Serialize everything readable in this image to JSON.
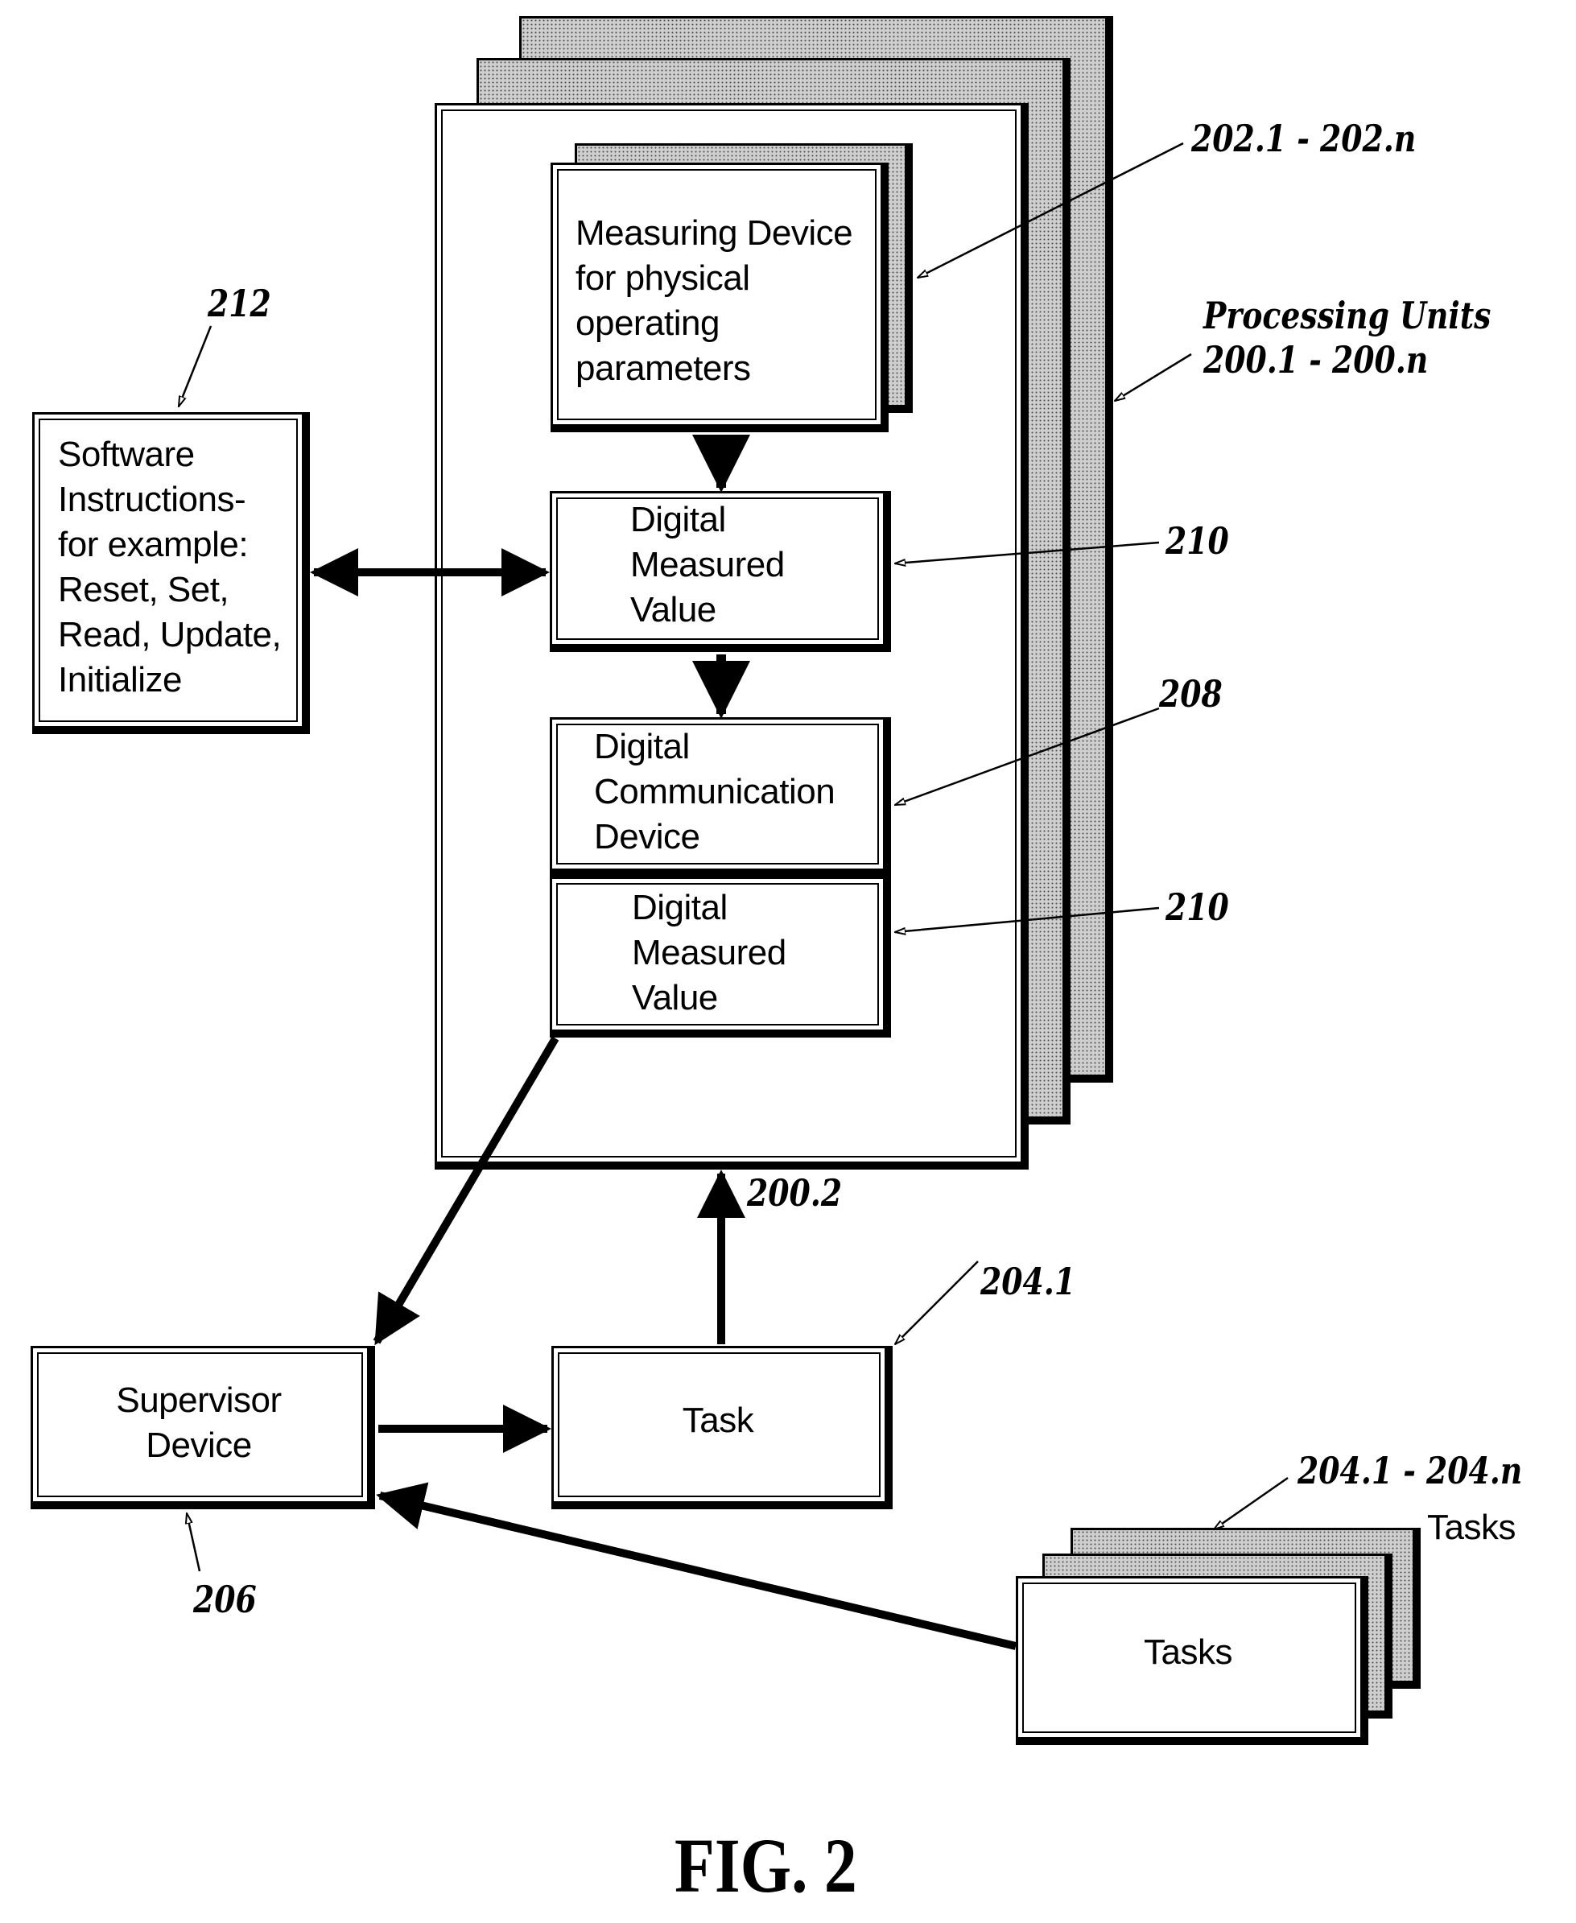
{
  "figure": {
    "caption": "FIG. 2"
  },
  "processing_units": {
    "ref": "Processing Units",
    "ref_range": "200.1 - 200.n",
    "measuring_device": {
      "ref": "202.1 - 202.n",
      "lines": [
        "Measuring Device",
        "for physical",
        "operating",
        "parameters"
      ]
    },
    "digital_measured_value_1": {
      "ref": "210",
      "lines": [
        "Digital",
        "Measured",
        "Value"
      ]
    },
    "digital_communication_device": {
      "ref": "208",
      "lines": [
        "Digital",
        "Communication",
        "Device"
      ]
    },
    "digital_measured_value_2": {
      "ref": "210",
      "lines": [
        "Digital",
        "Measured",
        "Value"
      ]
    },
    "unit_ref": "200.2"
  },
  "software_instructions": {
    "ref": "212",
    "lines": [
      "Software",
      "Instructions-",
      "for example:",
      "Reset, Set,",
      "Read, Update,",
      "Initialize"
    ]
  },
  "supervisor_device": {
    "ref": "206",
    "lines": [
      "Supervisor",
      "Device"
    ]
  },
  "task": {
    "ref": "204.1",
    "label": "Task"
  },
  "tasks_stack": {
    "ref": "204.1 - 204.n",
    "caption": "Tasks",
    "label": "Tasks"
  }
}
